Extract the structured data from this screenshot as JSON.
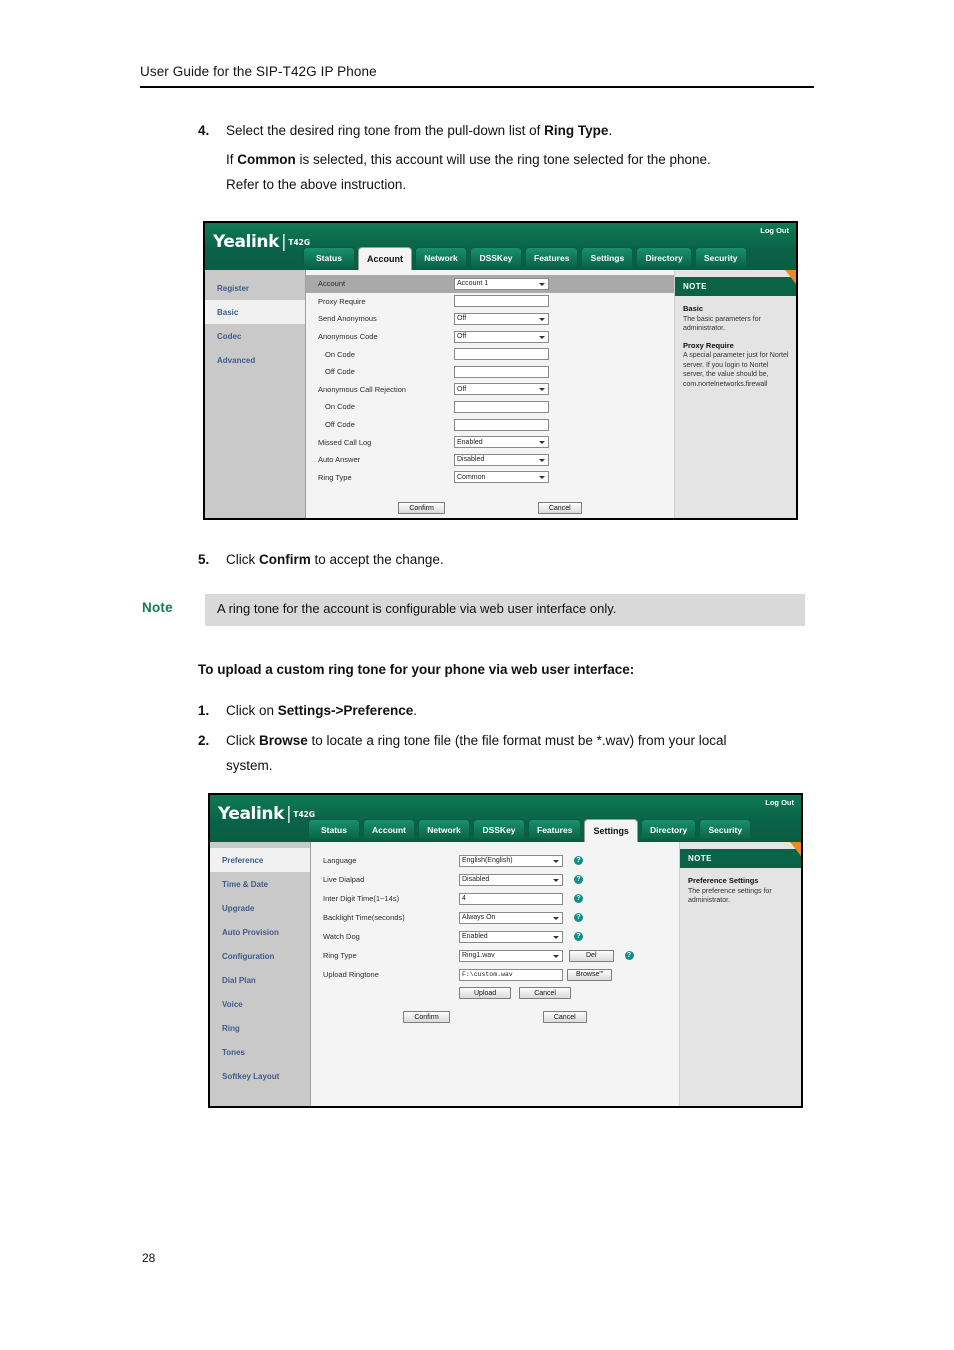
{
  "document": {
    "running_header": "User Guide for the SIP-T42G IP Phone",
    "page_number": "28"
  },
  "steps_top": [
    {
      "num": "4.",
      "line1_pre": "Select the desired ring tone from the pull-down list of ",
      "line1_bold": "Ring Type",
      "line1_post": ".",
      "line2_pre": "If ",
      "line2_bold": "Common",
      "line2_post": " is selected, this account will use the ring tone selected for the phone.",
      "line3": "Refer to the above instruction."
    }
  ],
  "step5": {
    "num": "5.",
    "pre": "Click ",
    "bold": "Confirm",
    "post": " to accept the change."
  },
  "note": {
    "label": "Note",
    "text": "A ring tone for the account is configurable via web user interface only.",
    "label_color": "#16794f",
    "box_color": "#d9d9d9"
  },
  "section_heading": "To upload a custom ring tone for your phone via web user interface:",
  "steps_bottom": [
    {
      "num": "1.",
      "pre": "Click on ",
      "bold": "Settings",
      "mid": "->",
      "bold2": "Preference",
      "post": "."
    },
    {
      "num": "2.",
      "pre": "Click ",
      "bold": "Browse",
      "post": " to locate a ring tone file (the file format must be *.wav) from your local",
      "line2": "system."
    }
  ],
  "screenshot_account": {
    "brand": "Yealink",
    "brand_separator": "|",
    "model": "T42G",
    "logout_label": "Log Out",
    "tabs": [
      {
        "label": "Status",
        "active": false
      },
      {
        "label": "Account",
        "active": true
      },
      {
        "label": "Network",
        "active": false
      },
      {
        "label": "DSSKey",
        "active": false
      },
      {
        "label": "Features",
        "active": false
      },
      {
        "label": "Settings",
        "active": false
      },
      {
        "label": "Directory",
        "active": false
      },
      {
        "label": "Security",
        "active": false
      }
    ],
    "sidebar": [
      {
        "label": "Register",
        "active": false
      },
      {
        "label": "Basic",
        "active": true
      },
      {
        "label": "Codec",
        "active": false
      },
      {
        "label": "Advanced",
        "active": false
      }
    ],
    "rows": [
      {
        "label": "Account",
        "control": "select",
        "value": "Account 1",
        "highlight": true,
        "indent": false
      },
      {
        "label": "Proxy Require",
        "control": "input",
        "value": "",
        "highlight": false,
        "indent": false
      },
      {
        "label": "Send Anonymous",
        "control": "select",
        "value": "Off",
        "highlight": false,
        "indent": false
      },
      {
        "label": "Anonymous Code",
        "control": "select",
        "value": "Off",
        "highlight": false,
        "indent": false
      },
      {
        "label": "On Code",
        "control": "input",
        "value": "",
        "highlight": false,
        "indent": true
      },
      {
        "label": "Off Code",
        "control": "input",
        "value": "",
        "highlight": false,
        "indent": true
      },
      {
        "label": "Anonymous Call Rejection",
        "control": "select",
        "value": "Off",
        "highlight": false,
        "indent": false
      },
      {
        "label": "On Code",
        "control": "input",
        "value": "",
        "highlight": false,
        "indent": true
      },
      {
        "label": "Off Code",
        "control": "input",
        "value": "",
        "highlight": false,
        "indent": true
      },
      {
        "label": "Missed Call Log",
        "control": "select",
        "value": "Enabled",
        "highlight": false,
        "indent": false
      },
      {
        "label": "Auto Answer",
        "control": "select",
        "value": "Disabled",
        "highlight": false,
        "indent": false
      },
      {
        "label": "Ring Type",
        "control": "select",
        "value": "Common",
        "highlight": false,
        "indent": false
      }
    ],
    "buttons": {
      "confirm": "Confirm",
      "cancel": "Cancel"
    },
    "note_panel": {
      "title": "NOTE",
      "blocks": [
        {
          "heading": "Basic",
          "text": "The basic parameters for administrator."
        },
        {
          "heading": "Proxy Require",
          "text": "A special parameter just for Nortel server. If you login to Nortel server, the value should be, com.nortelnetworks.firewall"
        }
      ]
    }
  },
  "screenshot_settings": {
    "brand": "Yealink",
    "brand_separator": "|",
    "model": "T42G",
    "logout_label": "Log Out",
    "tabs": [
      {
        "label": "Status",
        "active": false
      },
      {
        "label": "Account",
        "active": false
      },
      {
        "label": "Network",
        "active": false
      },
      {
        "label": "DSSKey",
        "active": false
      },
      {
        "label": "Features",
        "active": false
      },
      {
        "label": "Settings",
        "active": true
      },
      {
        "label": "Directory",
        "active": false
      },
      {
        "label": "Security",
        "active": false
      }
    ],
    "sidebar": [
      {
        "label": "Preference",
        "active": true
      },
      {
        "label": "Time & Date",
        "active": false
      },
      {
        "label": "Upgrade",
        "active": false
      },
      {
        "label": "Auto Provision",
        "active": false
      },
      {
        "label": "Configuration",
        "active": false
      },
      {
        "label": "Dial Plan",
        "active": false
      },
      {
        "label": "Voice",
        "active": false
      },
      {
        "label": "Ring",
        "active": false
      },
      {
        "label": "Tones",
        "active": false
      },
      {
        "label": "Softkey Layout",
        "active": false
      }
    ],
    "rows": [
      {
        "label": "Language",
        "control": "select",
        "value": "English(English)",
        "help": true
      },
      {
        "label": "Live Dialpad",
        "control": "select",
        "value": "Disabled",
        "help": true
      },
      {
        "label": "Inter Digit Time(1~14s)",
        "control": "input",
        "value": "4",
        "help": true
      },
      {
        "label": "Backlight Time(seconds)",
        "control": "select",
        "value": "Always On",
        "help": true
      },
      {
        "label": "Watch Dog",
        "control": "select",
        "value": "Enabled",
        "help": true
      },
      {
        "label": "Ring Type",
        "control": "select",
        "value": "Ring1.wav",
        "help": true,
        "extra_button": "Del"
      },
      {
        "label": "Upload Ringtone",
        "control": "file",
        "value": "F:\\custom.wav",
        "help": false,
        "extra_button": "Browse\"'"
      }
    ],
    "upload_buttons": {
      "upload": "Upload",
      "cancel": "Cancel"
    },
    "buttons": {
      "confirm": "Confirm",
      "cancel": "Cancel"
    },
    "note_panel": {
      "title": "NOTE",
      "blocks": [
        {
          "heading": "Preference Settings",
          "text": "The preference settings for administrator."
        }
      ]
    }
  },
  "theme": {
    "green": "#0a6347",
    "green_light": "#18916a",
    "orange": "#ef8a22",
    "sidebar_gray": "#c9c9c9",
    "help_teal": "#0f8f86"
  }
}
